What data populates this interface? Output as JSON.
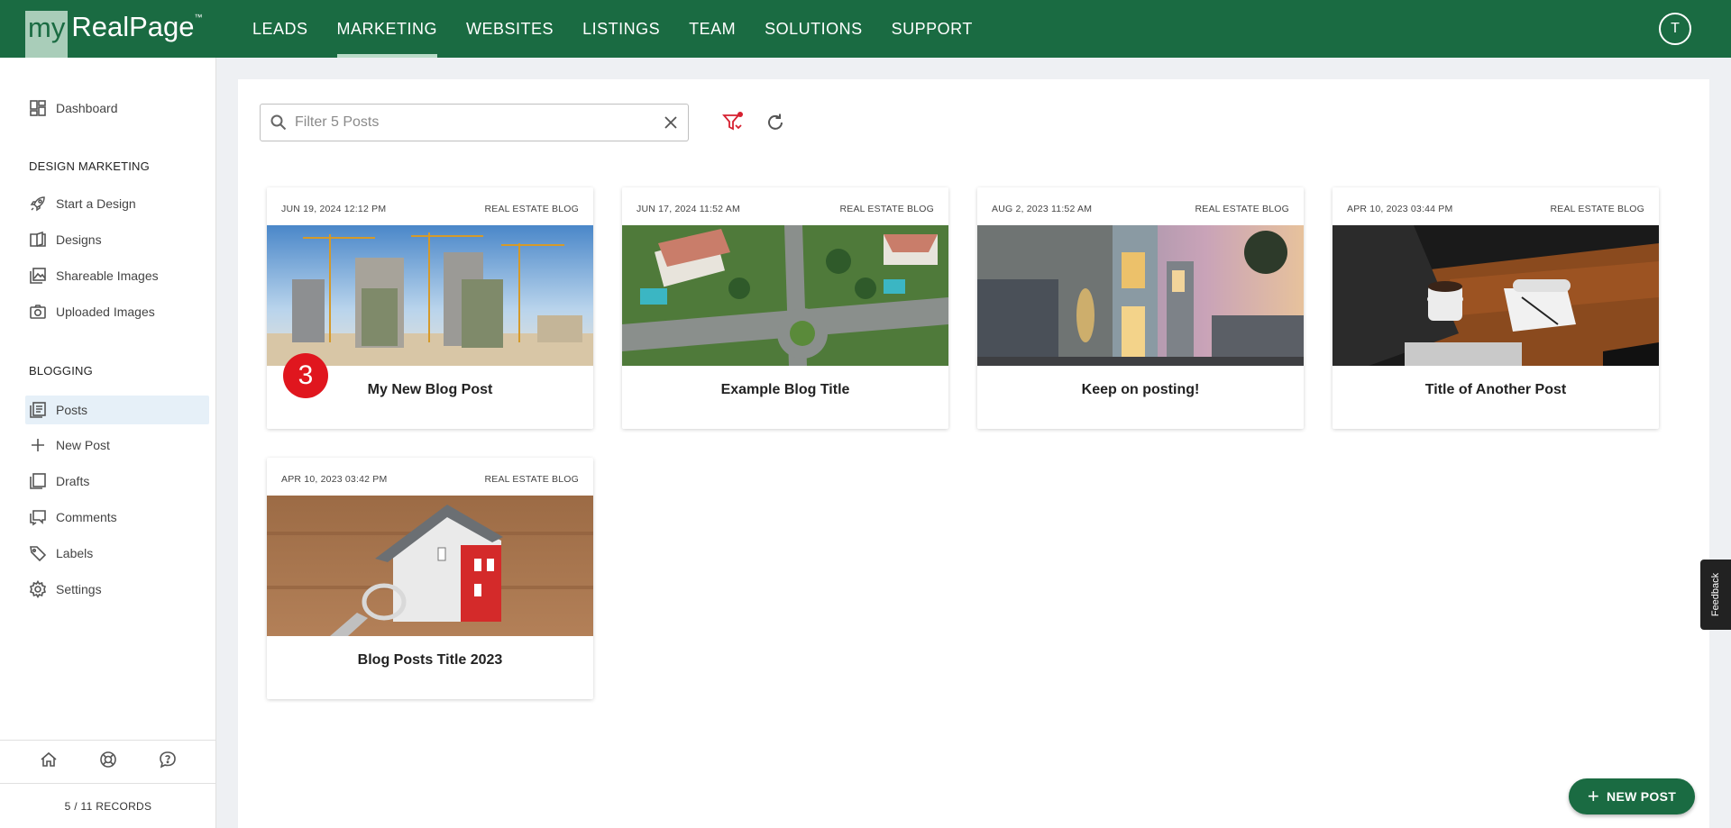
{
  "brand": {
    "prefix": "my",
    "name": "RealPage",
    "tm": "™"
  },
  "nav": {
    "items": [
      "LEADS",
      "MARKETING",
      "WEBSITES",
      "LISTINGS",
      "TEAM",
      "SOLUTIONS",
      "SUPPORT"
    ],
    "active": "MARKETING"
  },
  "user": {
    "initial": "T"
  },
  "sidebar": {
    "dashboard": "Dashboard",
    "design_heading": "DESIGN MARKETING",
    "design_items": [
      "Start a Design",
      "Designs",
      "Shareable Images",
      "Uploaded Images"
    ],
    "blogging_heading": "BLOGGING",
    "blogging_items": [
      "Posts",
      "New Post",
      "Drafts",
      "Comments",
      "Labels",
      "Settings"
    ],
    "active": "Posts",
    "records": "5 / 11 RECORDS"
  },
  "toolbar": {
    "search_placeholder": "Filter 5 Posts"
  },
  "posts": [
    {
      "date": "JUN 19, 2024 12:12 PM",
      "category": "REAL ESTATE BLOG",
      "title": "My New Blog Post",
      "badge": "3"
    },
    {
      "date": "JUN 17, 2024 11:52 AM",
      "category": "REAL ESTATE BLOG",
      "title": "Example Blog Title"
    },
    {
      "date": "AUG 2, 2023 11:52 AM",
      "category": "REAL ESTATE BLOG",
      "title": "Keep on posting!"
    },
    {
      "date": "APR 10, 2023 03:44 PM",
      "category": "REAL ESTATE BLOG",
      "title": "Title of Another Post"
    },
    {
      "date": "APR 10, 2023 03:42 PM",
      "category": "REAL ESTATE BLOG",
      "title": "Blog Posts Title 2023"
    }
  ],
  "feedback_label": "Feedback",
  "fab_label": "NEW POST",
  "colors": {
    "brand_green": "#1a6b42",
    "badge_red": "#e0161e",
    "active_bg": "#e6f0f8"
  }
}
